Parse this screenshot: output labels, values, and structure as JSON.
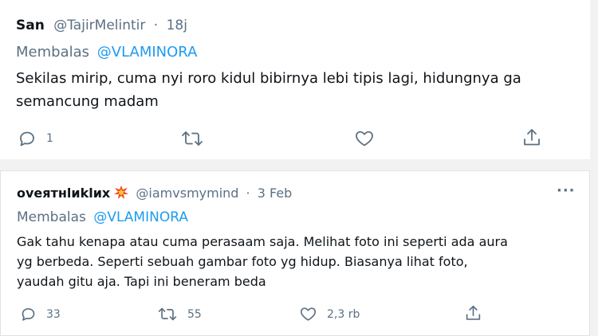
{
  "tweet1": {
    "name": "San",
    "handle": "@TajirMelintir",
    "separator": "·",
    "time": "18j",
    "reply_prefix": "Membalas",
    "reply_to": "@VLAMINORA",
    "text_line1": "Sekilas mirip, cuma nyi roro kidul bibirnya lebi tipis lagi, hidungnya ga",
    "text_line2": "semancung madam",
    "reply_count": "1",
    "retweet_count": "",
    "like_count": ""
  },
  "tweet2": {
    "name": "oveятнlиklих",
    "handle": "@iamvsmymind",
    "separator": "·",
    "time": "3 Feb",
    "more": "···",
    "reply_prefix": "Membalas",
    "reply_to": "@VLAMINORA",
    "text_lines": [
      "Gak tahu kenapa atau cuma perasaam saja. Melihat foto ini seperti ada aura",
      "yg berbeda. Seperti sebuah gambar foto yg hidup. Biasanya lihat foto,",
      "yaudah gitu aja. Tapi ini beneram beda"
    ],
    "reply_count": "33",
    "retweet_count": "55",
    "like_count": "2,3 rb"
  },
  "icons": {
    "reply": "reply-icon",
    "retweet": "retweet-icon",
    "like": "heart-icon",
    "share": "share-icon",
    "emoji": "explosion-emoji-icon"
  },
  "colors": {
    "link": "#1d9bf0",
    "muted": "#5b7083",
    "text": "#0f1419"
  }
}
